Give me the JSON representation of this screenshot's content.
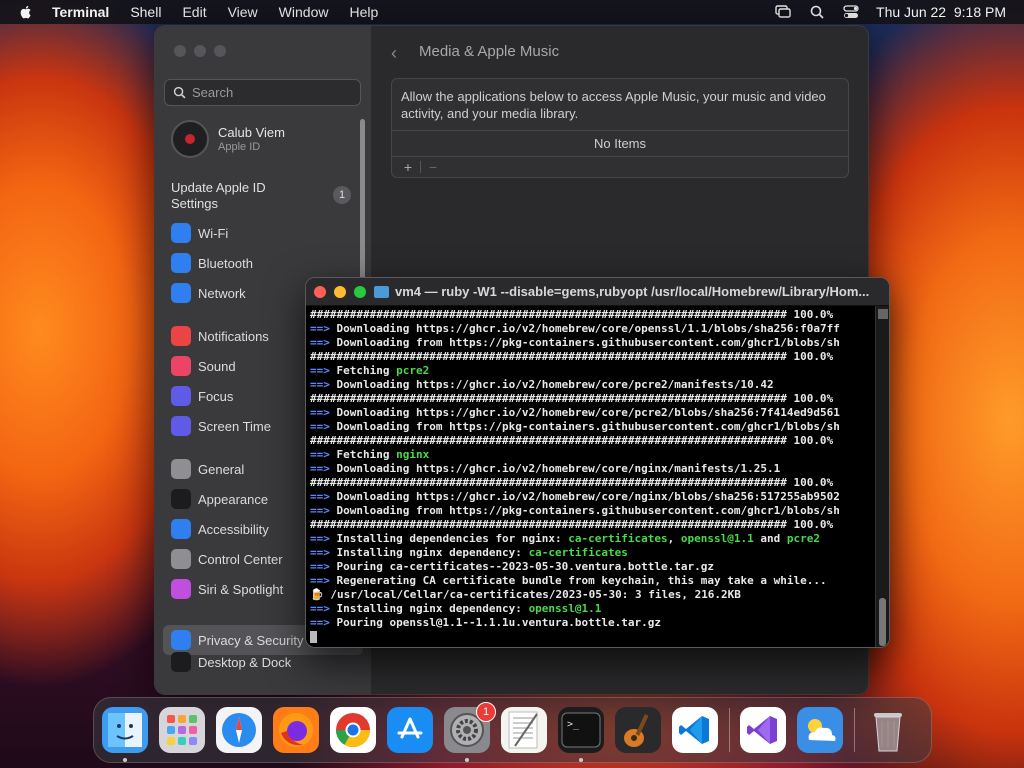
{
  "menubar": {
    "app": "Terminal",
    "items": [
      "Shell",
      "Edit",
      "View",
      "Window",
      "Help"
    ],
    "datetime": "Thu Jun 22  9:18 PM"
  },
  "settings": {
    "search_placeholder": "Search",
    "account": {
      "name": "Calub Viem",
      "subtitle": "Apple ID"
    },
    "update": {
      "label": "Update Apple ID Settings",
      "badge": "1"
    },
    "sidebar": [
      {
        "label": "Wi-Fi",
        "icon": "wifi-icon",
        "color": "#2f7ff0"
      },
      {
        "label": "Bluetooth",
        "icon": "bluetooth-icon",
        "color": "#2f7ff0"
      },
      {
        "label": "Network",
        "icon": "globe-icon",
        "color": "#2f7ff0"
      },
      {
        "label": "Notifications",
        "icon": "bell-icon",
        "color": "#ec4444"
      },
      {
        "label": "Sound",
        "icon": "speaker-icon",
        "color": "#ec4466"
      },
      {
        "label": "Focus",
        "icon": "moon-icon",
        "color": "#5e5ce6"
      },
      {
        "label": "Screen Time",
        "icon": "hourglass-icon",
        "color": "#5e5ce6"
      },
      {
        "label": "General",
        "icon": "gear-icon",
        "color": "#8e8e93"
      },
      {
        "label": "Appearance",
        "icon": "appearance-icon",
        "color": "#1c1c1e"
      },
      {
        "label": "Accessibility",
        "icon": "accessibility-icon",
        "color": "#2f7ff0"
      },
      {
        "label": "Control Center",
        "icon": "control-center-icon",
        "color": "#8e8e93"
      },
      {
        "label": "Siri & Spotlight",
        "icon": "siri-icon",
        "color": "#c04fe0"
      },
      {
        "label": "Privacy & Security",
        "icon": "hand-icon",
        "color": "#2f7ff0"
      },
      {
        "label": "Desktop & Dock",
        "icon": "dock-icon",
        "color": "#1c1c1e"
      }
    ],
    "content": {
      "title": "Media & Apple Music",
      "description": "Allow the applications below to access Apple Music, your music and video activity, and your media library.",
      "empty": "No Items",
      "add": "+",
      "remove": "−"
    }
  },
  "terminal": {
    "title": "vm4 — ruby -W1 --disable=gems,rubyopt /usr/local/Homebrew/Library/Hom...",
    "lines": [
      {
        "p": "",
        "t": "######################################################################## 100.0%",
        "c": "plain"
      },
      {
        "p": "==>",
        "t": " Downloading https://ghcr.io/v2/homebrew/core/openssl/1.1/blobs/sha256:f0a7ff",
        "c": "plain"
      },
      {
        "p": "==>",
        "t": " Downloading from https://pkg-containers.githubusercontent.com/ghcr1/blobs/sh",
        "c": "plain"
      },
      {
        "p": "",
        "t": "######################################################################## 100.0%",
        "c": "plain"
      },
      {
        "p": "==>",
        "t": " Fetching ",
        "g": "pcre2",
        "c": "fetch"
      },
      {
        "p": "==>",
        "t": " Downloading https://ghcr.io/v2/homebrew/core/pcre2/manifests/10.42",
        "c": "plain"
      },
      {
        "p": "",
        "t": "######################################################################## 100.0%",
        "c": "plain"
      },
      {
        "p": "==>",
        "t": " Downloading https://ghcr.io/v2/homebrew/core/pcre2/blobs/sha256:7f414ed9d561",
        "c": "plain"
      },
      {
        "p": "==>",
        "t": " Downloading from https://pkg-containers.githubusercontent.com/ghcr1/blobs/sh",
        "c": "plain"
      },
      {
        "p": "",
        "t": "######################################################################## 100.0%",
        "c": "plain"
      },
      {
        "p": "==>",
        "t": " Fetching ",
        "g": "nginx",
        "c": "fetch"
      },
      {
        "p": "==>",
        "t": " Downloading https://ghcr.io/v2/homebrew/core/nginx/manifests/1.25.1",
        "c": "plain"
      },
      {
        "p": "",
        "t": "######################################################################## 100.0%",
        "c": "plain"
      },
      {
        "p": "==>",
        "t": " Downloading https://ghcr.io/v2/homebrew/core/nginx/blobs/sha256:517255ab9502",
        "c": "plain"
      },
      {
        "p": "==>",
        "t": " Downloading from https://pkg-containers.githubusercontent.com/ghcr1/blobs/sh",
        "c": "plain"
      },
      {
        "p": "",
        "t": "######################################################################## 100.0%",
        "c": "plain"
      },
      {
        "p": "==>",
        "t": " Installing dependencies for nginx: ",
        "c": "deps"
      },
      {
        "p": "==>",
        "t": " Installing nginx dependency: ",
        "g": "ca-certificates",
        "c": "fetch"
      },
      {
        "p": "==>",
        "t": " Pouring ca-certificates--2023-05-30.ventura.bottle.tar.gz",
        "c": "plain"
      },
      {
        "p": "==>",
        "t": " Regenerating CA certificate bundle from keychain, this may take a while...",
        "c": "plain"
      },
      {
        "p": "🍺",
        "t": " /usr/local/Cellar/ca-certificates/2023-05-30: 3 files, 216.2KB",
        "c": "beer"
      },
      {
        "p": "==>",
        "t": " Installing nginx dependency: ",
        "g": "openssl@1.1",
        "c": "fetch"
      },
      {
        "p": "==>",
        "t": " Pouring openssl@1.1--1.1.1u.ventura.bottle.tar.gz",
        "c": "plain"
      }
    ],
    "deps": {
      "a": "ca-certificates",
      "sep1": ", ",
      "b": "openssl@1.1",
      "sep2": " and ",
      "c": "pcre2"
    }
  },
  "dock": [
    {
      "name": "finder",
      "bg": "#3d9cf0",
      "running": true
    },
    {
      "name": "launchpad",
      "bg": "#d6d6da",
      "running": false
    },
    {
      "name": "safari",
      "bg": "#f4f4f6",
      "running": false
    },
    {
      "name": "firefox",
      "bg": "#ff7d16",
      "running": false
    },
    {
      "name": "chrome",
      "bg": "#ffffff",
      "running": false
    },
    {
      "name": "app-store",
      "bg": "#1a8df5",
      "running": false
    },
    {
      "name": "system-settings",
      "bg": "#8a8a8e",
      "running": true,
      "badge": "1"
    },
    {
      "name": "textedit",
      "bg": "#f5f5f0",
      "running": false
    },
    {
      "name": "terminal",
      "bg": "#1c1c1e",
      "running": true
    },
    {
      "name": "garageband",
      "bg": "#2a2a2c",
      "running": false
    },
    {
      "name": "vscode",
      "bg": "#ffffff",
      "running": false
    },
    {
      "name": "visual-studio",
      "bg": "#ffffff",
      "running": false
    },
    {
      "name": "weather",
      "bg": "#3a8ee6",
      "running": false
    },
    {
      "name": "trash",
      "bg": "transparent",
      "running": false
    }
  ]
}
